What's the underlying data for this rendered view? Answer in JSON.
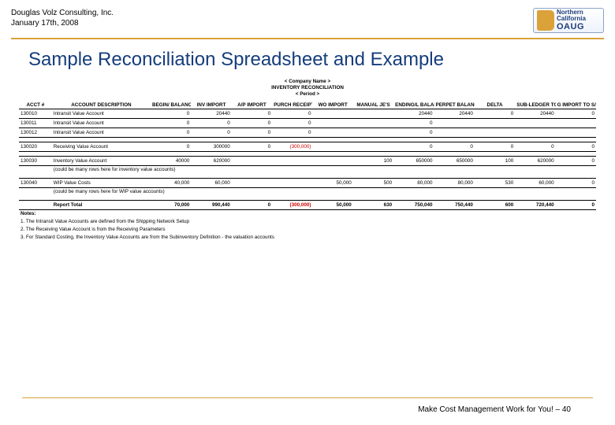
{
  "header": {
    "company": "Douglas Volz Consulting, Inc.",
    "date": "January 17th, 2008",
    "logo": {
      "line1": "Northern",
      "line2": "California",
      "oaug": "OAUG"
    }
  },
  "title": "Sample Reconciliation Spreadsheet and Example",
  "sheet": {
    "t1": "< Company Name >",
    "t2": "INVENTORY RECONCILIATION",
    "t3": "< Period >",
    "cols": [
      "ACCT #",
      "ACCOUNT DESCRIPTION",
      "BEGIN/ BALANCE",
      "INV IMPORT",
      "A/P IMPORT",
      "PURCH RECEIPT",
      "WO IMPORT",
      "MANUAL JE'S",
      "ENDING/L BALANCE",
      "PERPET BALANCE",
      "DELTA",
      "SUB-LEDGER TOTALS",
      "G IMPORT TO S/B-LEDGER DELTA"
    ],
    "rows": [
      {
        "a": "130010",
        "d": "Intransit Value Account",
        "v": [
          "0",
          "20440",
          "0",
          "0",
          "",
          "",
          "20440",
          "20440",
          "0",
          "20440",
          "0"
        ]
      },
      {
        "a": "130011",
        "d": "Intransit Value Account",
        "v": [
          "0",
          "0",
          "0",
          "0",
          "",
          "",
          "0",
          "",
          "",
          "",
          ""
        ]
      },
      {
        "a": "130012",
        "d": "Intransit Value Account",
        "v": [
          "0",
          "0",
          "0",
          "0",
          "",
          "",
          "0",
          "",
          "",
          "",
          ""
        ]
      }
    ],
    "recv": {
      "a": "130020",
      "d": "Receiving Value Account",
      "v": [
        "0",
        "300000",
        "0",
        "(300,000)",
        "",
        "",
        "0",
        "0",
        "0",
        "0",
        "0"
      ]
    },
    "inv": {
      "a": "130030",
      "d": "Inventory Value Account",
      "n": "(could be many rows here for inventory value accounts)",
      "v": [
        "40000",
        "620000",
        "",
        "",
        "",
        "100",
        "650000",
        "650000",
        "100",
        "620000",
        "0"
      ]
    },
    "wip": {
      "a": "130040",
      "d": "WIP Value Costs",
      "n": "(could be many rows here for WIP value accounts)",
      "v": [
        "40,000",
        "60,000",
        "",
        "",
        "50,000",
        "500",
        "80,000",
        "80,000",
        "530",
        "60,000",
        "0"
      ]
    },
    "total": {
      "d": "Report Total",
      "v": [
        "70,000",
        "990,440",
        "0",
        "(300,000)",
        "50,000",
        "630",
        "750,040",
        "750,440",
        "600",
        "720,440",
        "0"
      ]
    },
    "notes_h": "Notes:",
    "notes": [
      "1. The Intransit Value Accounts are defined from the Shipping Network Setup",
      "2. The Receiving Value Account is from the Receiving Parameters",
      "3. For Standard Costing, the Inventory Value Accounts are from the Subinventory Definition - the valuation accounts"
    ]
  },
  "footer": {
    "text": "Make Cost Management Work for You! – 40"
  }
}
